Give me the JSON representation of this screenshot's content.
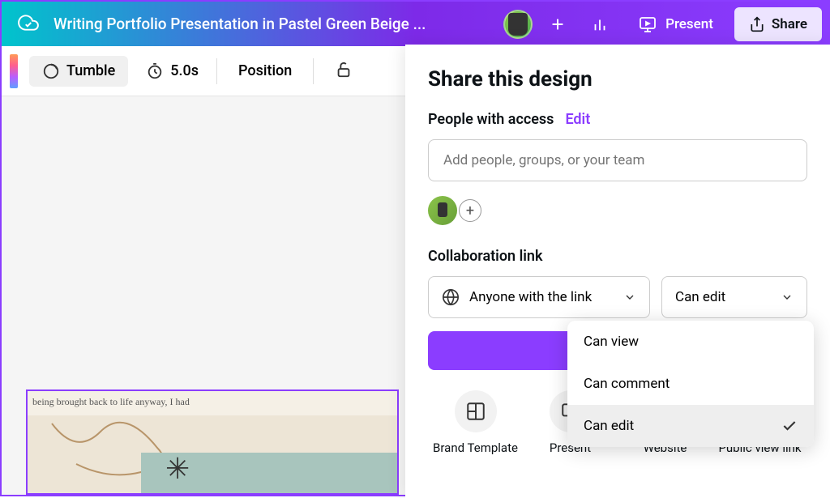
{
  "header": {
    "title": "Writing Portfolio Presentation in Pastel Green Beige ...",
    "present_label": "Present",
    "share_label": "Share"
  },
  "toolbar": {
    "tumble_label": "Tumble",
    "timer_value": "5.0s",
    "position_label": "Position"
  },
  "share_panel": {
    "title": "Share this design",
    "access_label": "People with access",
    "edit_label": "Edit",
    "people_placeholder": "Add people, groups, or your team",
    "collab_label": "Collaboration link",
    "link_scope": "Anyone with the link",
    "permission": "Can edit",
    "options": [
      {
        "label": "Brand Template"
      },
      {
        "label": "Present"
      },
      {
        "label": "Website"
      },
      {
        "label": "Public view link"
      }
    ]
  },
  "dropdown": {
    "items": [
      {
        "label": "Can view",
        "selected": false
      },
      {
        "label": "Can comment",
        "selected": false
      },
      {
        "label": "Can edit",
        "selected": true
      }
    ]
  },
  "canvas": {
    "fragment_text": "being brought back to life anyway, I had"
  }
}
